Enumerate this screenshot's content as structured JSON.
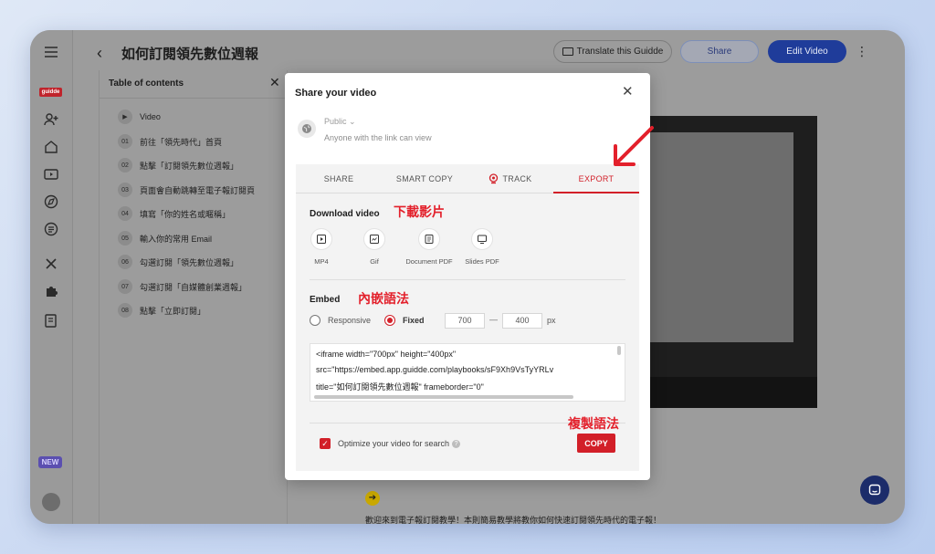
{
  "header": {
    "title": "如何訂閱領先數位週報",
    "translate_label": "Translate this Guidde",
    "share_label": "Share",
    "edit_label": "Edit Video"
  },
  "rail": {
    "logo": "guidde",
    "new_badge": "NEW"
  },
  "toc": {
    "title": "Table of contents",
    "video_label": "Video",
    "items": [
      {
        "num": "01",
        "label": "前往「領先時代」首頁"
      },
      {
        "num": "02",
        "label": "點擊「訂閱領先數位週報」"
      },
      {
        "num": "03",
        "label": "頁面會自動跳轉至電子報訂閱頁"
      },
      {
        "num": "04",
        "label": "填寫「你的姓名或暱稱」"
      },
      {
        "num": "05",
        "label": "輸入你的常用 Email"
      },
      {
        "num": "06",
        "label": "勾選訂閱「領先數位週報」"
      },
      {
        "num": "07",
        "label": "勾選訂閱「自媒體創業週報」"
      },
      {
        "num": "08",
        "label": "點擊「立即訂閱」"
      }
    ]
  },
  "below_text": "歡迎來到電子報訂閱教學！本則簡易教學將教你如何快速訂閱領先時代的電子報！",
  "modal": {
    "title": "Share your video",
    "visibility": "Public",
    "visibility_desc": "Anyone with the link can view",
    "tabs": [
      {
        "label": "SHARE"
      },
      {
        "label": "SMART COPY"
      },
      {
        "label": "TRACK"
      },
      {
        "label": "EXPORT"
      }
    ],
    "download_title": "Download video",
    "download_annotation": "下載影片",
    "downloads": [
      {
        "label": "MP4"
      },
      {
        "label": "Gif"
      },
      {
        "label": "Document PDF"
      },
      {
        "label": "Slides PDF"
      }
    ],
    "embed_title": "Embed",
    "embed_annotation": "內嵌語法",
    "responsive_label": "Responsive",
    "fixed_label": "Fixed",
    "width_value": "700",
    "height_value": "400",
    "dash": "—",
    "px_unit": "px",
    "code_lines": [
      "<iframe width=\"700px\" height=\"400px\"",
      "src=\"https://embed.app.guidde.com/playbooks/sF9Xh9VsTyYRLv",
      "title=\"如何訂閱領先數位週報\" frameborder=\"0\""
    ],
    "optimize_label": "Optimize your video for search",
    "copy_annotation": "複製語法",
    "copy_label": "COPY"
  },
  "colors": {
    "accent": "#d21f28",
    "annotation": "#e3202b",
    "primary_blue": "#1f3c9a"
  }
}
